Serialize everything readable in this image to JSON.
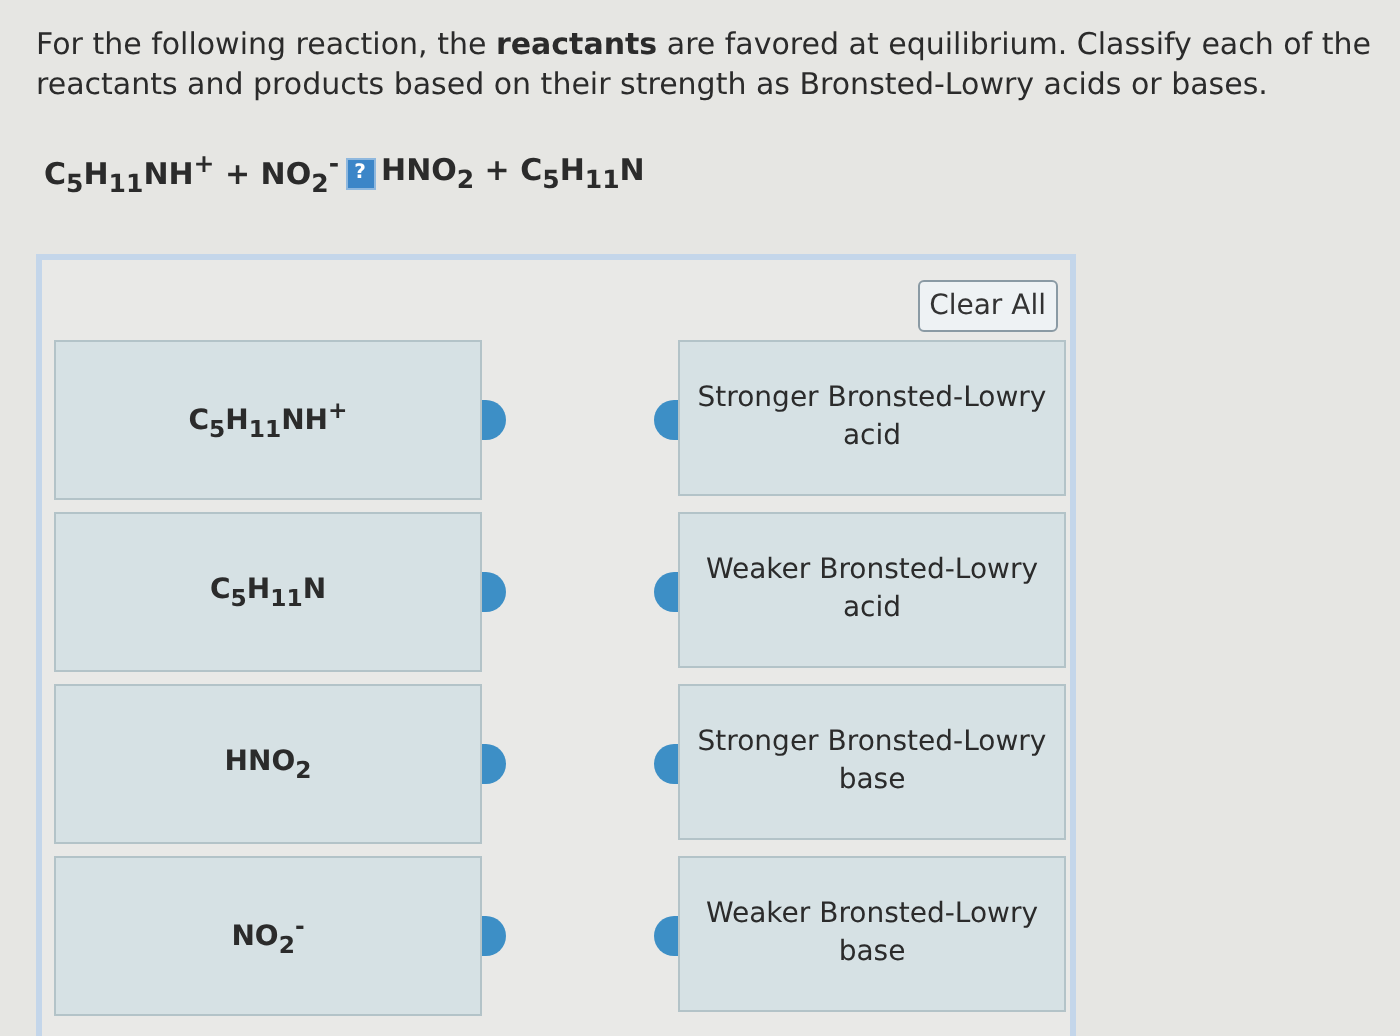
{
  "question": {
    "text": "For the following reaction, the **reactants** are favored at equilibrium. Classify each of the reactants and products based on their strength as Bronsted-Lowry acids or bases."
  },
  "equation": {
    "left": "C$_{5}$H$_{11}$NH$^{+}$ + NO$_{2}$$^{-}$",
    "arrow_glyph": "?",
    "right": "HNO$_{2}$ + C$_{5}$H$_{11}$N"
  },
  "clear_button": {
    "label": "Clear All"
  },
  "species": [
    {
      "label": "C$_{5}$H$_{11}$NH$^{+}$"
    },
    {
      "label": "C$_{5}$H$_{11}$N"
    },
    {
      "label": "HNO$_{2}$"
    },
    {
      "label": "NO$_{2}$$^{-}$"
    }
  ],
  "categories": [
    {
      "label": "Stronger Bronsted-Lowry acid"
    },
    {
      "label": "Weaker Bronsted-Lowry acid"
    },
    {
      "label": "Stronger Bronsted-Lowry base"
    },
    {
      "label": "Weaker Bronsted-Lowry base"
    }
  ]
}
